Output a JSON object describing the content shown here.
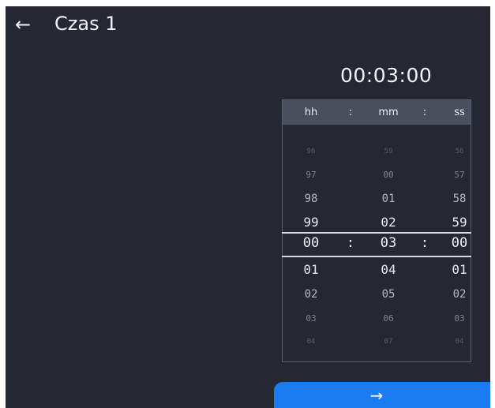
{
  "header": {
    "back_icon": "left-arrow-icon",
    "back_glyph": "←",
    "title": "Czas 1"
  },
  "time_display": "00:03:00",
  "picker": {
    "labels": {
      "hours": "hh",
      "separator1": ":",
      "minutes": "mm",
      "separator2": ":",
      "seconds": "ss"
    },
    "hours": [
      "96",
      "97",
      "98",
      "99",
      "00",
      "01",
      "02",
      "03",
      "04"
    ],
    "minutes": [
      "59",
      "00",
      "01",
      "02",
      "03",
      "04",
      "05",
      "06",
      "07"
    ],
    "seconds": [
      "56",
      "57",
      "58",
      "59",
      "00",
      "01",
      "02",
      "03",
      "04"
    ],
    "selected": {
      "hours": "00",
      "minutes": "03",
      "seconds": "00",
      "separator": ":"
    }
  },
  "next_button": {
    "icon": "right-arrow-icon",
    "glyph": "→"
  },
  "colors": {
    "background": "#252733",
    "header_bar": "#4b4e5d",
    "accent": "#1b7cf2",
    "text": "#f2f3f7"
  }
}
